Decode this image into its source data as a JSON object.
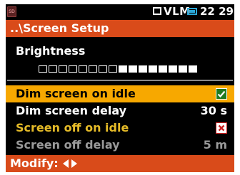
{
  "status_bar": {
    "sd_icon": "sd-card-icon",
    "mode": "VLM",
    "screen_icon": "screen-icon",
    "clock": "22 29"
  },
  "title": "..\\Screen Setup",
  "brightness": {
    "label": "Brightness",
    "level_segments_filled": 8,
    "total_segments": 16
  },
  "items": [
    {
      "label": "Dim screen on idle",
      "type": "checkbox",
      "checked": true,
      "selected": true
    },
    {
      "label": "Dim screen delay",
      "value": "30 s"
    },
    {
      "label": "Screen off on idle",
      "type": "checkbox",
      "checked": false
    },
    {
      "label": "Screen off delay",
      "value": "5 m",
      "disabled": true
    }
  ],
  "footer": {
    "label": "Modify:",
    "left_icon": "left-arrow-icon",
    "right_icon": "right-arrow-icon"
  },
  "colors": {
    "background": "#000000",
    "title_bar": "#d94b1a",
    "selected_row": "#f7a800",
    "checkbox_on": "#1f7a1f",
    "checkbox_off_mark": "#cc2222",
    "secondary_text": "#e5bb28",
    "disabled_text": "#9a9a9a"
  }
}
